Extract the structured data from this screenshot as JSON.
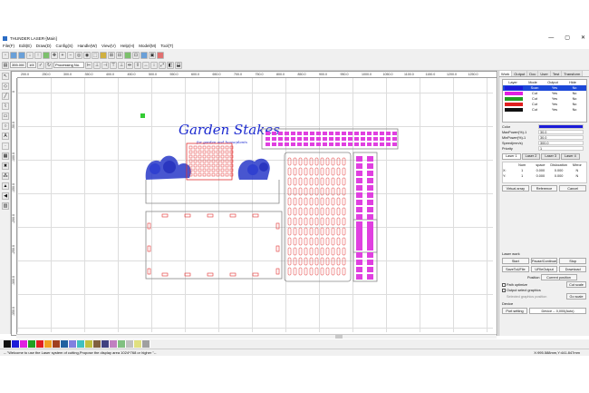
{
  "window": {
    "title": "THUNDER LASER-[Main]",
    "minimize": "—",
    "maximize": "▢",
    "close": "✕"
  },
  "menu": [
    "File(F)",
    "Edit(E)",
    "Draw(D)",
    "Config(S)",
    "Handle(W)",
    "View(V)",
    "Help(H)",
    "Model(M)",
    "Tool(T)"
  ],
  "toolbar": {
    "pos_x": "355.000",
    "pos_y": "154.060",
    "size_w": "100",
    "size_h": "100",
    "zoom": "Processing No."
  },
  "ruler": {
    "h_ticks": [
      "200.0",
      "250.0",
      "300.0",
      "350.0",
      "400.0",
      "450.0",
      "500.0",
      "550.0",
      "600.0",
      "650.0",
      "700.0",
      "750.0",
      "800.0",
      "850.0",
      "900.0",
      "950.0",
      "1000.0",
      "1050.0",
      "1100.0",
      "1150.0",
      "1200.0",
      "1250.0"
    ],
    "v_ticks": [
      "0",
      "-50.0",
      "-100.0",
      "-150.0",
      "-200.0",
      "-250.0",
      "-300.0",
      "-350.0",
      "-400.0"
    ]
  },
  "artwork": {
    "title_line1": "Garden Stakes",
    "title_line2": "for garden and houseplants"
  },
  "right_panel": {
    "tabs": [
      "Work",
      "Output",
      "Doc",
      "User",
      "Test",
      "Transform"
    ],
    "layer_headers": [
      "Layer",
      "Mode",
      "Output",
      "Hide"
    ],
    "layers": [
      {
        "color": "#1c1cd8",
        "mode": "Scan",
        "output": "Yes",
        "hide": "No",
        "selected": true
      },
      {
        "color": "#e020e0",
        "mode": "Cut",
        "output": "Yes",
        "hide": "No",
        "selected": false
      },
      {
        "color": "#20a020",
        "mode": "Cut",
        "output": "Yes",
        "hide": "No",
        "selected": false
      },
      {
        "color": "#e02020",
        "mode": "Cut",
        "output": "Yes",
        "hide": "No",
        "selected": false
      },
      {
        "color": "#111111",
        "mode": "Cut",
        "output": "Yes",
        "hide": "No",
        "selected": false
      }
    ],
    "props": [
      {
        "k": "Color",
        "v": ""
      },
      {
        "k": "MaxPower(%)-1",
        "v": "30.0"
      },
      {
        "k": "MinPower(%)-1",
        "v": "30.0"
      },
      {
        "k": "Speed(mm/s)",
        "v": "300.0"
      },
      {
        "k": "Priority",
        "v": "1"
      }
    ],
    "layer_subtabs": [
      "Laser 1",
      "Laser 2",
      "Laser 3",
      "Laser 4"
    ],
    "array_headers": [
      "Num",
      "space",
      "Dislocation",
      "Mirror"
    ],
    "array_rows": [
      {
        "axis": "X:",
        "num": "1",
        "space": "0.000",
        "disl": "0.000",
        "mirror": "N"
      },
      {
        "axis": "Y:",
        "num": "1",
        "space": "0.000",
        "disl": "0.000",
        "mirror": "N"
      }
    ],
    "array_buttons": [
      "Virtual array",
      "Reference",
      "Cancel"
    ],
    "laser_work": "Laser work",
    "work_buttons": [
      [
        "Start",
        "Pause/Continue",
        "Stop"
      ],
      [
        "SaveToUFile",
        "UFileOutput",
        "Download"
      ]
    ],
    "position_label": "Position",
    "position_value": "Current position",
    "checks": [
      "Path optimize",
      "Output select graphics",
      "Selected graphics position"
    ],
    "side_buttons": [
      "Cut scale",
      "Go scale"
    ],
    "device_label": "Device",
    "port_button": "Port setting",
    "device_value": "Device -- 0,000(Auto)"
  },
  "palette": [
    "#111111",
    "#1c1cd8",
    "#e020e0",
    "#20a020",
    "#e02020",
    "#f0a020",
    "#a04020",
    "#2060a0",
    "#8080e0",
    "#40c0c0",
    "#c0c040",
    "#806040",
    "#404080",
    "#c080c0",
    "#80c080",
    "#c0c0c0",
    "#e0e080",
    "#a0a0a0"
  ],
  "status": {
    "message": "-- \"Welcome to use the Laser system of cutting,Propose the display area 1024*768 or higher \"--",
    "coords": "X:995.588mm,Y:441.847mm"
  }
}
